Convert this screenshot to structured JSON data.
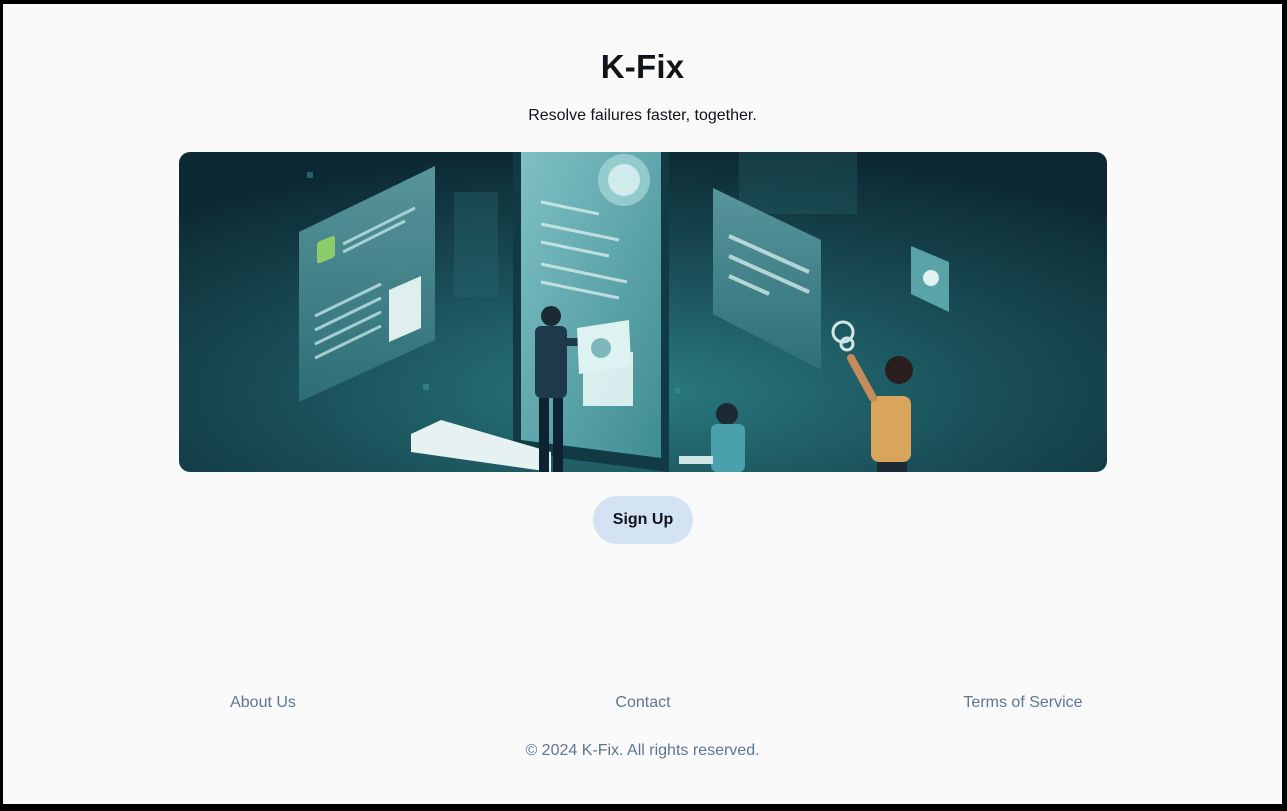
{
  "header": {
    "title": "K-Fix",
    "tagline": "Resolve failures faster, together."
  },
  "hero": {
    "illustration": "isometric-team-troubleshooting-illustration",
    "colors": {
      "background_dark": "#0e2f3a",
      "background_mid": "#1c5a63",
      "panel": "#8fc3c6"
    }
  },
  "cta": {
    "signup_label": "Sign Up",
    "background": "#d3e3f4"
  },
  "footer": {
    "links": [
      {
        "label": "About Us"
      },
      {
        "label": "Contact"
      },
      {
        "label": "Terms of Service"
      }
    ],
    "copyright": "© 2024 K-Fix. All rights reserved."
  }
}
